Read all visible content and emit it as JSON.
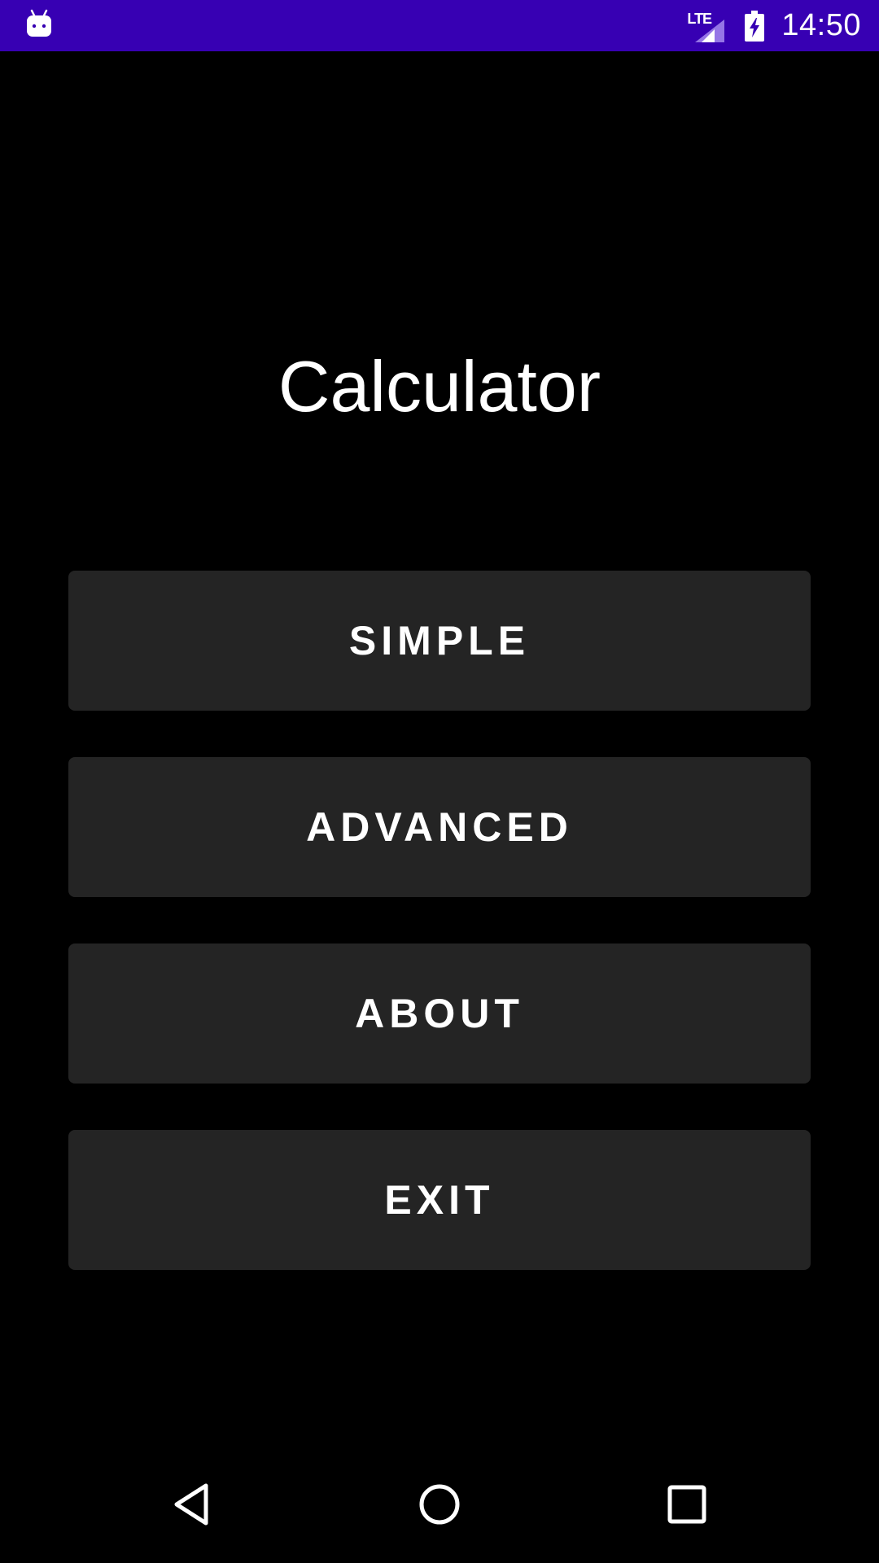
{
  "status_bar": {
    "time": "14:50",
    "network": "LTE",
    "background_color": "#3700b3",
    "icons": [
      "android-debug-icon",
      "lte-signal-icon",
      "battery-charging-icon"
    ]
  },
  "app": {
    "title": "Calculator"
  },
  "menu": {
    "buttons": [
      {
        "label": "SIMPLE"
      },
      {
        "label": "ADVANCED"
      },
      {
        "label": "ABOUT"
      },
      {
        "label": "EXIT"
      }
    ],
    "button_color": "#242424"
  },
  "nav_bar": {
    "icons": [
      "back-icon",
      "home-icon",
      "recents-icon"
    ]
  }
}
